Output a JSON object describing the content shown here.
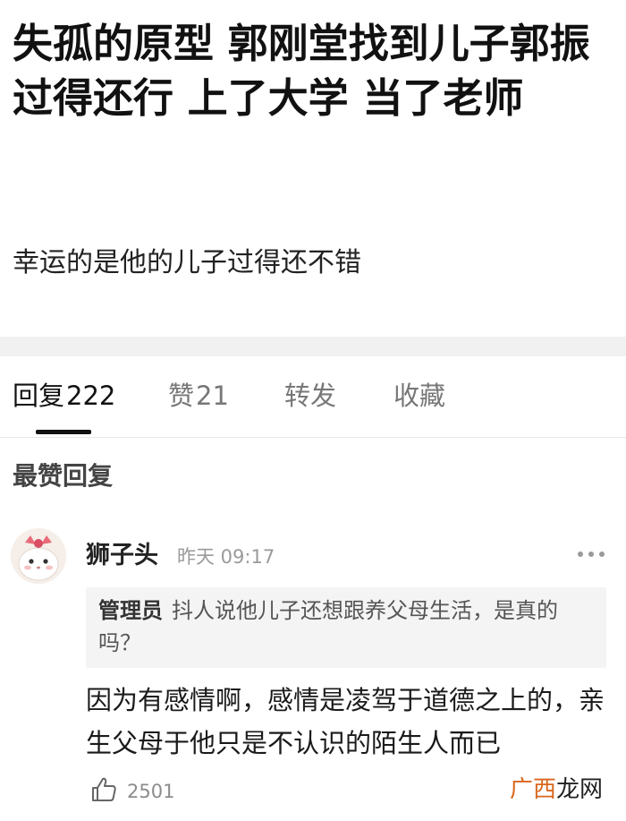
{
  "article": {
    "title": "失孤的原型 郭刚堂找到儿子郭振 过得还行 上了大学 当了老师",
    "subtitle": "幸运的是他的儿子过得还不错"
  },
  "tabs": [
    {
      "label": "回复",
      "count": "222"
    },
    {
      "label": "赞",
      "count": "21"
    },
    {
      "label": "转发",
      "count": ""
    },
    {
      "label": "收藏",
      "count": ""
    }
  ],
  "section_title": "最赞回复",
  "comment": {
    "username": "狮子头",
    "timestamp": "昨天 09:17",
    "quote_author": "管理员",
    "quote_text": "抖人说他儿子还想跟养父母生活，是真的吗？",
    "body": "因为有感情啊，感情是凌驾于道德之上的，亲生父母于他只是不认识的陌生人而已",
    "like_count": "2501"
  },
  "watermark": {
    "part1": "广西",
    "part2": "龙网"
  },
  "colors": {
    "text_primary": "#111111",
    "text_secondary": "#777777",
    "band": "#f1f1f1",
    "quote_bg": "#f4f4f4",
    "watermark_accent": "#d9661c"
  }
}
